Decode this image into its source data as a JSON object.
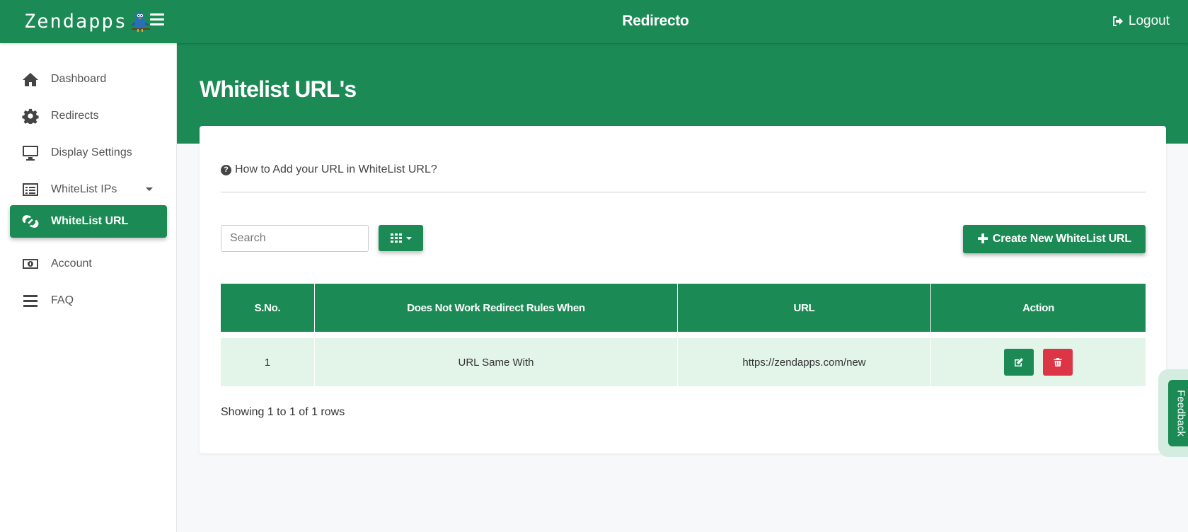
{
  "header": {
    "brand": "Zendapps",
    "app_title": "Redirecto",
    "logout_label": "Logout"
  },
  "sidebar": {
    "items": [
      {
        "label": "Dashboard",
        "icon": "home-icon"
      },
      {
        "label": "Redirects",
        "icon": "gear-icon"
      },
      {
        "label": "Display Settings",
        "icon": "monitor-icon"
      },
      {
        "label": "WhiteList IPs",
        "icon": "list-icon"
      },
      {
        "label": "WhiteList URL",
        "icon": "link-icon",
        "active": true
      },
      {
        "label": "Account",
        "icon": "money-icon"
      },
      {
        "label": "FAQ",
        "icon": "bars-icon"
      }
    ]
  },
  "main": {
    "title": "Whitelist URL's",
    "howto_label": "How to Add your URL in WhiteList URL?",
    "search_placeholder": "Search",
    "create_label": "Create New WhiteList URL",
    "table": {
      "headers": [
        "S.No.",
        "Does Not Work Redirect Rules When",
        "URL",
        "Action"
      ],
      "rows": [
        {
          "sno": "1",
          "condition": "URL Same With",
          "url": "https://zendapps.com/new"
        }
      ]
    },
    "pagination_text": "Showing 1 to 1 of 1 rows"
  },
  "feedback_label": "Feedback",
  "colors": {
    "primary": "#1b8a55",
    "danger": "#dc3545",
    "row_bg": "#e3f4e8"
  }
}
